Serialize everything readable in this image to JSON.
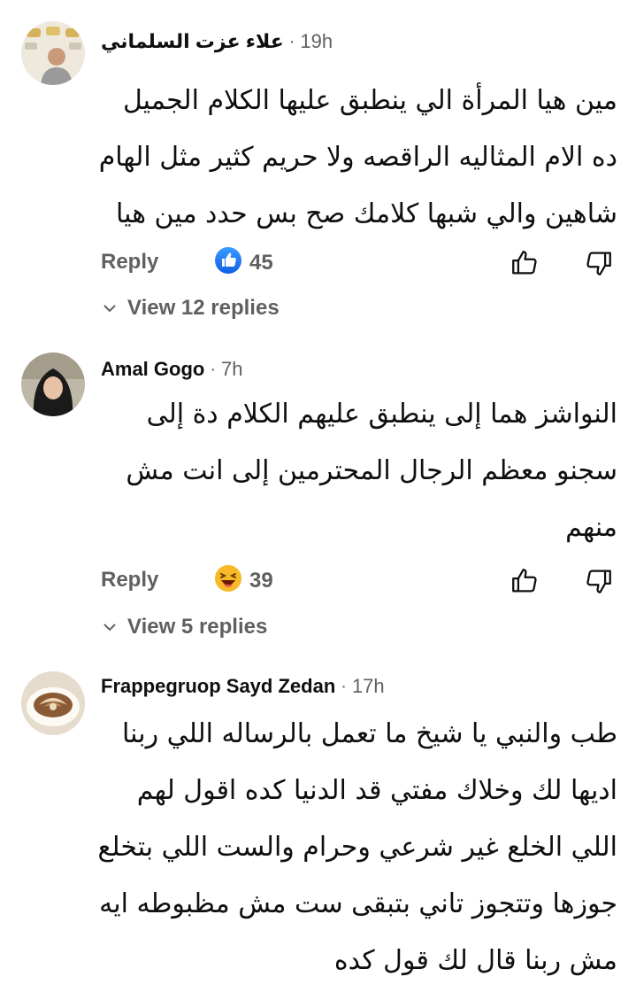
{
  "comments": [
    {
      "author": "علاء عزت السلماني",
      "separator": "·",
      "time": "19h",
      "text": "مين هيا المرأة الي ينطبق عليها الكلام الجميل ده الام المثاليه الراقصه ولا حريم كثير مثل الهام شاهين والي شبها كلامك صح بس حدد مين هيا",
      "reply_label": "Reply",
      "reaction_icon": "thumbs-up-badge-icon",
      "reaction_count": "45",
      "view_replies": "View 12 replies"
    },
    {
      "author": "Amal Gogo",
      "separator": "·",
      "time": "7h",
      "text": "النواشز هما إلى ينطبق عليهم الكلام دة إلى سجنو معظم الرجال المحترمين إلى انت مش منهم",
      "reply_label": "Reply",
      "reaction_icon": "laughing-emoji-icon",
      "reaction_count": "39",
      "view_replies": "View 5 replies"
    },
    {
      "author": "Frappegruop Sayd Zedan",
      "separator": "·",
      "time": "17h",
      "text": "طب والنبي يا شيخ ما تعمل بالرساله اللي ربنا اديها لك وخلاك مفتي قد الدنيا كده اقول لهم اللي الخلع غير شرعي وحرام والست اللي بتخلع جوزها وتتجوز تاني بتبقى ست مش مظبوطه ايه مش ربنا قال لك قول كده"
    }
  ],
  "colors": {
    "text": "#0f0f0f",
    "secondary": "#606060",
    "like_blue": "#1877f2",
    "emoji_yellow": "#f7b928"
  }
}
